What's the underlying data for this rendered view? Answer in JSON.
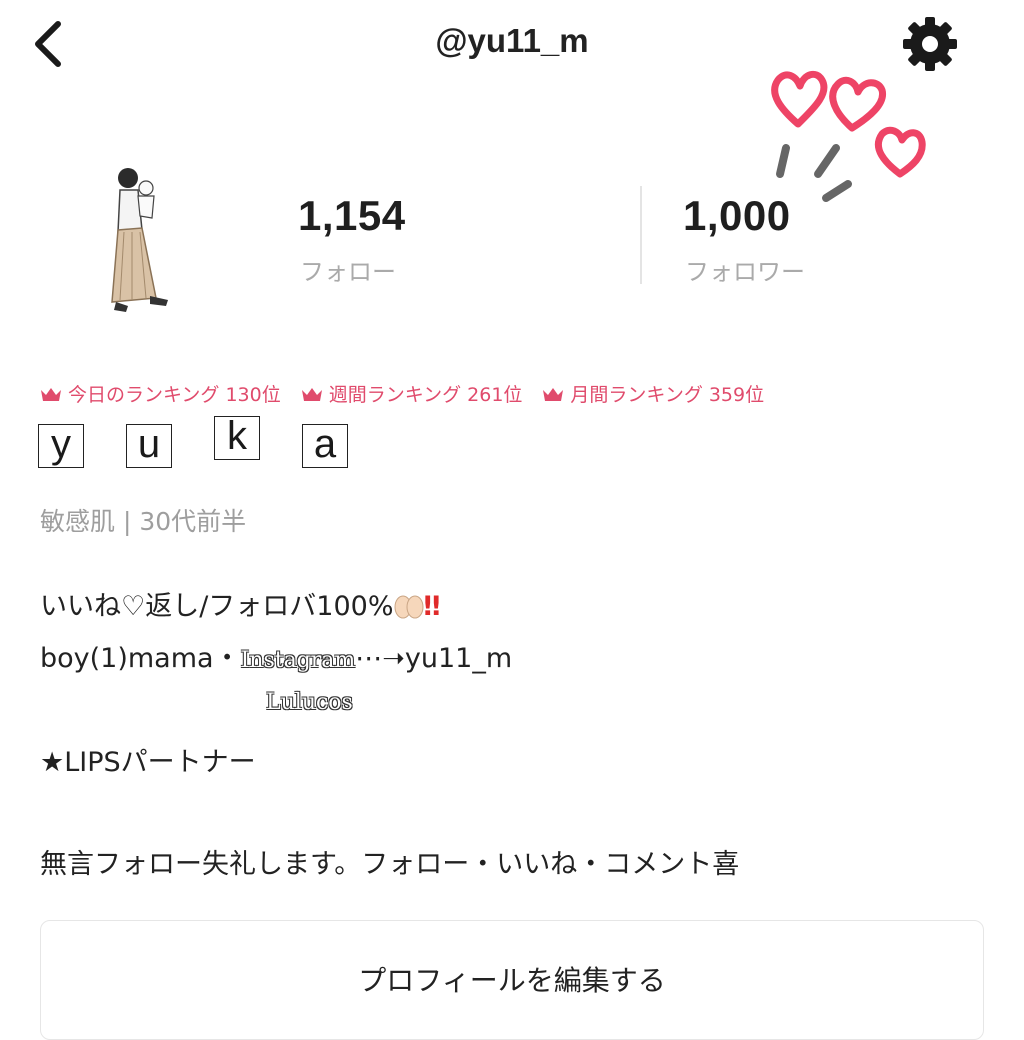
{
  "header": {
    "username": "@yu11_m",
    "back_icon": "chevron-left-icon",
    "settings_icon": "gear-icon"
  },
  "stats": {
    "follow_count": "1,154",
    "follow_label": "フォロー",
    "follower_count": "1,000",
    "follower_label": "フォロワー"
  },
  "rankings": [
    {
      "label": "今日のランキング",
      "value": "130位"
    },
    {
      "label": "週間ランキング",
      "value": "261位"
    },
    {
      "label": "月間ランキング",
      "value": "359位"
    }
  ],
  "profile": {
    "display_name_chars": [
      "y",
      "u",
      "k",
      "a"
    ],
    "meta": "敏感肌 | 30代前半"
  },
  "bio": {
    "line1_text": "いいね♡返し/フォロバ100%",
    "line1_exclaim": "‼︎",
    "line2_prefix": "boy(1)mama・",
    "line2_instagram": "Instagram",
    "line2_suffix": "⋯➝yu11_m",
    "line3": "Lulucos",
    "line4": "★LIPSパートナー",
    "line5": "無言フォロー失礼します。フォロー・いいね・コメント喜"
  },
  "actions": {
    "edit_profile_label": "プロフィールを編集する"
  },
  "colors": {
    "accent": "#e04b6c",
    "heart": "#ee4466",
    "muted_text": "#aaaaaa"
  }
}
